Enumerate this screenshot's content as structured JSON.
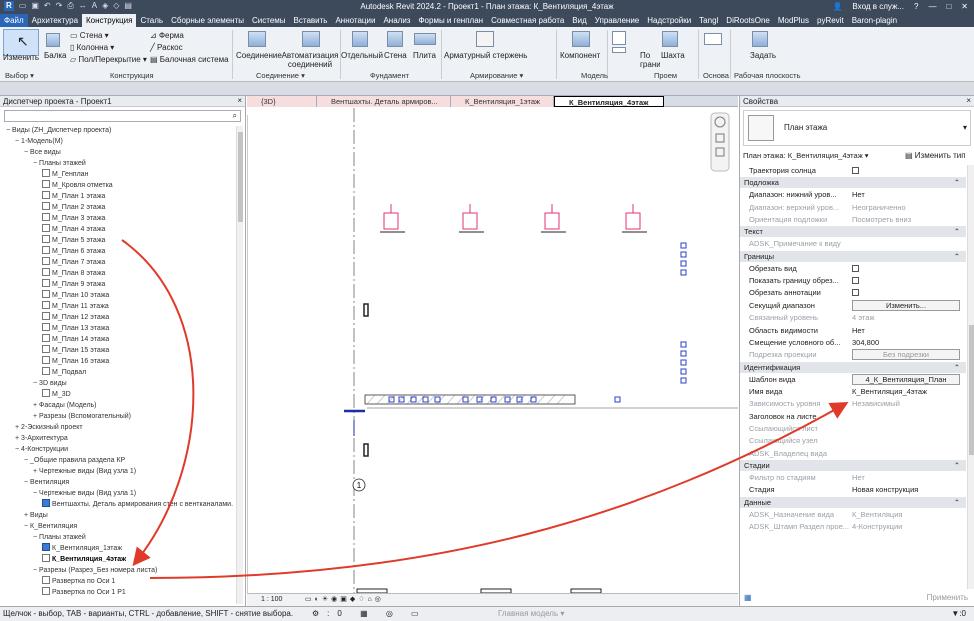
{
  "app": {
    "title": "Autodesk Revit 2024.2 - Проект1 - План этажа: К_Вентиляция_4этаж",
    "user": "Вход в служ...",
    "help": "?"
  },
  "menu": [
    "Файл",
    "Архитектура",
    "Конструкция",
    "Сталь",
    "Сборные элементы",
    "Системы",
    "Вставить",
    "Аннотации",
    "Анализ",
    "Формы и генплан",
    "Совместная работа",
    "Вид",
    "Управление",
    "Надстройки",
    "Tangl",
    "DiRootsOne",
    "ModPlus",
    "pyRevit",
    "Baron-plagin"
  ],
  "ribbon": {
    "modify": "Изменить",
    "beam": "Балка",
    "wall": "Стена",
    "column": "Колонна",
    "floor": "Пол/Перекрытие",
    "truss": "Ферма",
    "brace": "Раскос",
    "beam_system": "Балочная система",
    "connection": "Соединение",
    "automation": "Автоматизация соединений",
    "isolated": "Отдельный",
    "wall_f": "Стена",
    "slab": "Плита",
    "rebar": "Арматурный стержень",
    "component": "Компонент",
    "by_face": "По грани",
    "shaft": "Шахта",
    "set": "Задать",
    "groups": [
      "Выбор",
      "Конструкция",
      "Соединение",
      "Фундамент",
      "Армирование",
      "Модель",
      "Проем",
      "Основа",
      "Рабочая плоскость"
    ]
  },
  "browser": {
    "title": "Диспетчер проекта - Проект1",
    "close": "×",
    "items": [
      "Виды (ZH_Диспетчер проекта)",
      "1-Модель(М)",
      "Все виды",
      "Планы этажей",
      "М_Генплан",
      "М_Кровля отметка",
      "М_План 1 этажа",
      "М_План 2 этажа",
      "М_План 3 этажа",
      "М_План 4 этажа",
      "М_План 5 этажа",
      "М_План 6 этажа",
      "М_План 7 этажа",
      "М_План 8 этажа",
      "М_План 9 этажа",
      "М_План 10 этажа",
      "М_План 11 этажа",
      "М_План 12 этажа",
      "М_План 13 этажа",
      "М_План 14 этажа",
      "М_План 15 этажа",
      "М_План 16 этажа",
      "М_Подвал",
      "3D виды",
      "М_3D",
      "Фасады (Модель)",
      "Разрезы (Вспомогательный)",
      "2-Эскизный проект",
      "3-Архитектура",
      "4-Конструкции",
      "_Общие правила раздела КР",
      "Чертежные виды (Вид узла 1)",
      "Вентиляция",
      "Чертежные виды (Вид узла 1)",
      "Вентшахты. Деталь армирования стен с вентканалами.",
      "Виды",
      "К_Вентиляция",
      "Планы этажей",
      "К_Вентиляция_1этаж",
      "К_Вентиляция_4этаж",
      "Разрезы (Разрез_Без номера листа)",
      "Развертка по Оси 1",
      "Развертка по Оси 1 Р1"
    ]
  },
  "view_tabs": [
    "{3D}",
    "Вентшахты. Деталь армиров...",
    "К_Вентиляция_1этаж",
    "К_Вентиляция_4этаж"
  ],
  "canvas": {
    "grid_marker": "1"
  },
  "view_status": {
    "scale": "1 : 100",
    "main_model": "Главная модель"
  },
  "props": {
    "title": "Свойства",
    "type_name": "План этажа",
    "selector": "План этажа: К_Вентиляция_4этаж",
    "edit_type": "Изменить тип",
    "rows": [
      {
        "k": "Траектория солнца",
        "cb": true
      },
      {
        "sec": "Подложка"
      },
      {
        "k": "Диапазон: нижний уров...",
        "v": "Нет"
      },
      {
        "k": "Диапазон: верхний уров...",
        "v": "Неограниченно",
        "g": true
      },
      {
        "k": "Ориентация подложки",
        "v": "Посмотреть вниз",
        "g": true
      },
      {
        "sec": "Текст"
      },
      {
        "k": "ADSK_Примечание к виду",
        "g": true
      },
      {
        "sec": "Границы"
      },
      {
        "k": "Обрезать вид",
        "cb": true
      },
      {
        "k": "Показать границу обрез...",
        "cb": true
      },
      {
        "k": "Обрезать аннотации",
        "cb": true
      },
      {
        "k": "Секущий диапазон",
        "btn": "Изменить..."
      },
      {
        "k": "Связанный уровень",
        "v": "4 этаж",
        "g": true
      },
      {
        "k": "Область видимости",
        "v": "Нет"
      },
      {
        "k": "Смещение условного об...",
        "v": "304,800"
      },
      {
        "k": "Подрезка проекции",
        "btn": "Без подрезки",
        "g": true
      },
      {
        "sec": "Идентификация"
      },
      {
        "k": "Шаблон вида",
        "btn": "4_К_Вентиляция_План"
      },
      {
        "k": "Имя вида",
        "v": "К_Вентиляция_4этаж"
      },
      {
        "k": "Зависимость уровня",
        "v": "Независимый",
        "g": true
      },
      {
        "k": "Заголовок на листе"
      },
      {
        "k": "Ссылающийся лист",
        "g": true
      },
      {
        "k": "Ссылающийся узел",
        "g": true
      },
      {
        "k": "ADSK_Владелец вида",
        "g": true
      },
      {
        "sec": "Стадии"
      },
      {
        "k": "Фильтр по стадиям",
        "v": "Нет",
        "g": true
      },
      {
        "k": "Стадия",
        "v": "Новая конструкция"
      },
      {
        "sec": "Данные"
      },
      {
        "k": "ADSK_Назначение вида",
        "v": "К_Вентиляция",
        "g": true
      },
      {
        "k": "ADSK_Штамп Раздел прое...",
        "v": "4-Конструкции",
        "g": true
      }
    ],
    "apply": "Применить"
  },
  "status": {
    "hint": "Щелчок - выбор, TAB - варианты, CTRL - добавление, SHIFT - снятие выбора."
  },
  "colors": {
    "arrow": "#e03a2a",
    "pink": "#e2337a",
    "blue": "#2a3fcc"
  }
}
